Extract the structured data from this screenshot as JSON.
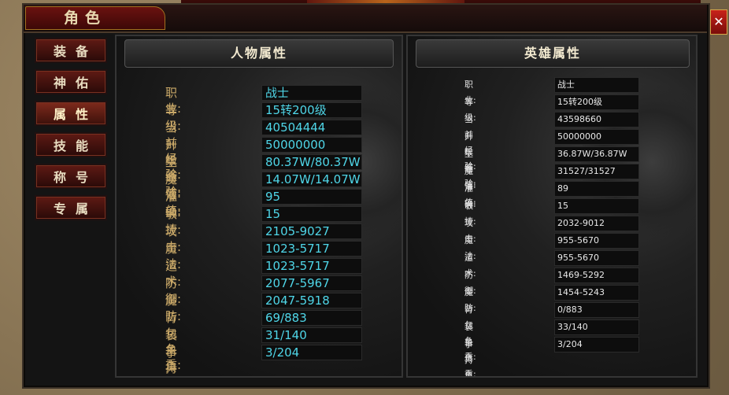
{
  "window": {
    "title": "角色",
    "close_symbol": "✕"
  },
  "sidebar": {
    "items": [
      {
        "label": "装备",
        "active": false
      },
      {
        "label": "神佑",
        "active": false
      },
      {
        "label": "属性",
        "active": true
      },
      {
        "label": "技能",
        "active": false
      },
      {
        "label": "称号",
        "active": false
      },
      {
        "label": "专属",
        "active": false
      }
    ]
  },
  "character_panel": {
    "title": "人物属性",
    "rows": [
      {
        "label": "职　业:",
        "value": "战士"
      },
      {
        "label": "等　级:",
        "value": "15转200级"
      },
      {
        "label": "当前经验:",
        "value": "40504444"
      },
      {
        "label": "升级经验:",
        "value": "50000000"
      },
      {
        "label": "生命值:",
        "value": "80.37W/80.37W"
      },
      {
        "label": "魔法值:",
        "value": "14.07W/14.07W"
      },
      {
        "label": "准　　确:",
        "value": "95"
      },
      {
        "label": "敏　　捷:",
        "value": "15"
      },
      {
        "label": "攻　　击:",
        "value": "2105-9027"
      },
      {
        "label": "魔　　法:",
        "value": "1023-5717"
      },
      {
        "label": "道　　术:",
        "value": "1023-5717"
      },
      {
        "label": "防　　御:",
        "value": "2077-5967"
      },
      {
        "label": "魔　　防:",
        "value": "2047-5918"
      },
      {
        "label": "背包负重:",
        "value": "69/883"
      },
      {
        "label": "装备负重:",
        "value": "31/140"
      },
      {
        "label": "手持负重:",
        "value": "3/204"
      }
    ]
  },
  "hero_panel": {
    "title": "英雄属性",
    "rows": [
      {
        "label": "职　业:",
        "value": "战士"
      },
      {
        "label": "等　级:",
        "value": "15转200级"
      },
      {
        "label": "当前经验:",
        "value": "43598660"
      },
      {
        "label": "升级经验:",
        "value": "50000000"
      },
      {
        "label": "生 命 值:",
        "value": "36.87W/36.87W"
      },
      {
        "label": "魔 法 值:",
        "value": "31527/31527"
      },
      {
        "label": "准　　确:",
        "value": "89"
      },
      {
        "label": "敏　　捷:",
        "value": "15"
      },
      {
        "label": "攻　　击:",
        "value": "2032-9012"
      },
      {
        "label": "魔　　法:",
        "value": "955-5670"
      },
      {
        "label": "道　　术:",
        "value": "955-5670"
      },
      {
        "label": "防　　御:",
        "value": "1469-5292"
      },
      {
        "label": "魔　　防:",
        "value": "1454-5243"
      },
      {
        "label": "背包负重:",
        "value": "0/883"
      },
      {
        "label": "装备负重:",
        "value": "33/140"
      },
      {
        "label": "手持负重:",
        "value": "3/204"
      }
    ]
  }
}
